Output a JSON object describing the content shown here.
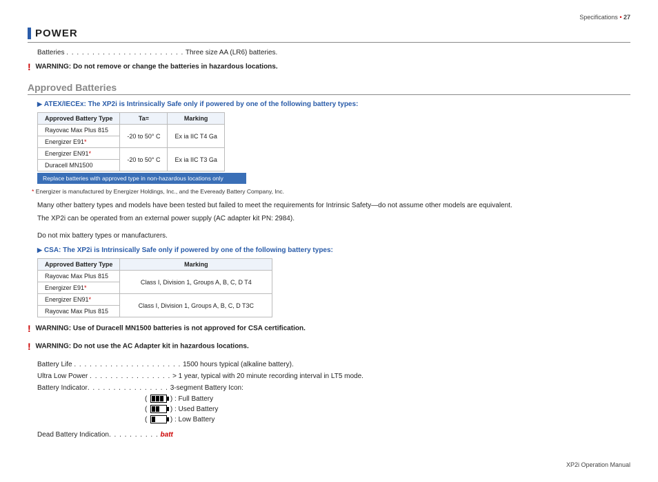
{
  "header": {
    "breadcrumb": "Specifications",
    "page": "27"
  },
  "section": {
    "title": "POWER"
  },
  "spec_batteries": {
    "label": "Batteries",
    "value": "Three size AA (LR6) batteries."
  },
  "warn1": {
    "label": "WARNING:",
    "text": "Do not remove or change the batteries in hazardous locations."
  },
  "approved": {
    "heading": "Approved Batteries"
  },
  "atex": {
    "heading": "ATEX/IECEx: The XP2i is Intrinsically Safe only if powered by one of the following battery types:",
    "cols": {
      "c1": "Approved Battery Type",
      "c2": "Ta=",
      "c3": "Marking"
    },
    "rows": [
      {
        "name": "Rayovac Max Plus 815",
        "ta": "-20 to 50° C",
        "mark": "Ex ia IIC T4 Ga"
      },
      {
        "name": "Energizer E91"
      },
      {
        "name": "Energizer EN91",
        "ta": "-20 to 50° C",
        "mark": "Ex ia IIC T3 Ga"
      },
      {
        "name": "Duracell MN1500"
      }
    ],
    "note": "Replace batteries with approved type in non-hazardous locations only"
  },
  "footnote_ast": "Energizer is manufactured by Energizer Holdings, Inc., and the Eveready Battery Company, Inc.",
  "para1": "Many other battery types and models have been tested but failed to meet the requirements for Intrinsic Safety—do not assume other models are equivalent.",
  "para2": "The XP2i can be operated from an external power supply (AC adapter kit PN: 2984).",
  "para3": "Do not mix battery types or manufacturers.",
  "csa": {
    "heading": "CSA: The XP2i is Intrinsically Safe only if powered by one of the following battery types:",
    "cols": {
      "c1": "Approved Battery Type",
      "c2": "Marking"
    },
    "rows": [
      {
        "name": "Rayovac Max Plus 815",
        "mark": "Class I, Division 1, Groups A, B, C, D  T4"
      },
      {
        "name": "Energizer E91"
      },
      {
        "name": "Energizer EN91",
        "mark": "Class I, Division 1, Groups A, B, C, D  T3C"
      },
      {
        "name": "Rayovac Max Plus 815"
      }
    ]
  },
  "warn2": {
    "label": "WARNING:",
    "text": "Use of Duracell MN1500 batteries is not approved for CSA certification."
  },
  "warn3": {
    "label": "WARNING:",
    "text": "Do not use the AC Adapter kit in hazardous locations."
  },
  "battlife": {
    "label": "Battery Life",
    "value": "1500 hours typical (alkaline battery)."
  },
  "ulp": {
    "label": "Ultra Low Power",
    "value": "> 1 year, typical with 20 minute recording interval in LT5 mode."
  },
  "battind": {
    "label": "Battery Indicator",
    "value": "3-segment Battery Icon:",
    "full": ") : Full Battery",
    "used": ") : Used Battery",
    "low": ") : Low Battery"
  },
  "dead": {
    "label": "Dead Battery Indication",
    "value": "batt"
  },
  "footer": "XP2i Operation Manual"
}
